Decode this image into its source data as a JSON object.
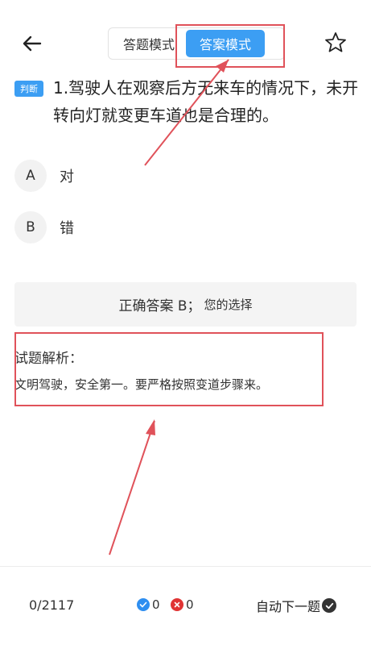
{
  "header": {
    "modes": [
      "答题模式",
      "答案模式"
    ],
    "active_mode": "答案模式"
  },
  "question": {
    "badge": "判断",
    "text": "1.驾驶人在观察后方无来车的情况下，未开转向灯就变更车道也是合理的。"
  },
  "options": [
    {
      "letter": "A",
      "text": "对"
    },
    {
      "letter": "B",
      "text": "错"
    }
  ],
  "answer": {
    "correct": "正确答案 B；",
    "your_choice": "您的选择"
  },
  "analysis": {
    "title": "试题解析：",
    "text": "文明驾驶，安全第一。要严格按照变道步骤来。"
  },
  "footer": {
    "progress": "0/2117",
    "correct_count": "0",
    "wrong_count": "0",
    "auto_next": "自动下一题"
  },
  "colors": {
    "accent": "#3c9ef3",
    "annotation": "#e0525a",
    "correct_icon": "#2e8ef0",
    "wrong_icon": "#e03434"
  },
  "icons": {
    "back": "arrow-left-icon",
    "star": "star-outline-icon",
    "correct": "check-circle-icon",
    "wrong": "x-circle-icon",
    "auto_next": "check-filled-icon"
  }
}
